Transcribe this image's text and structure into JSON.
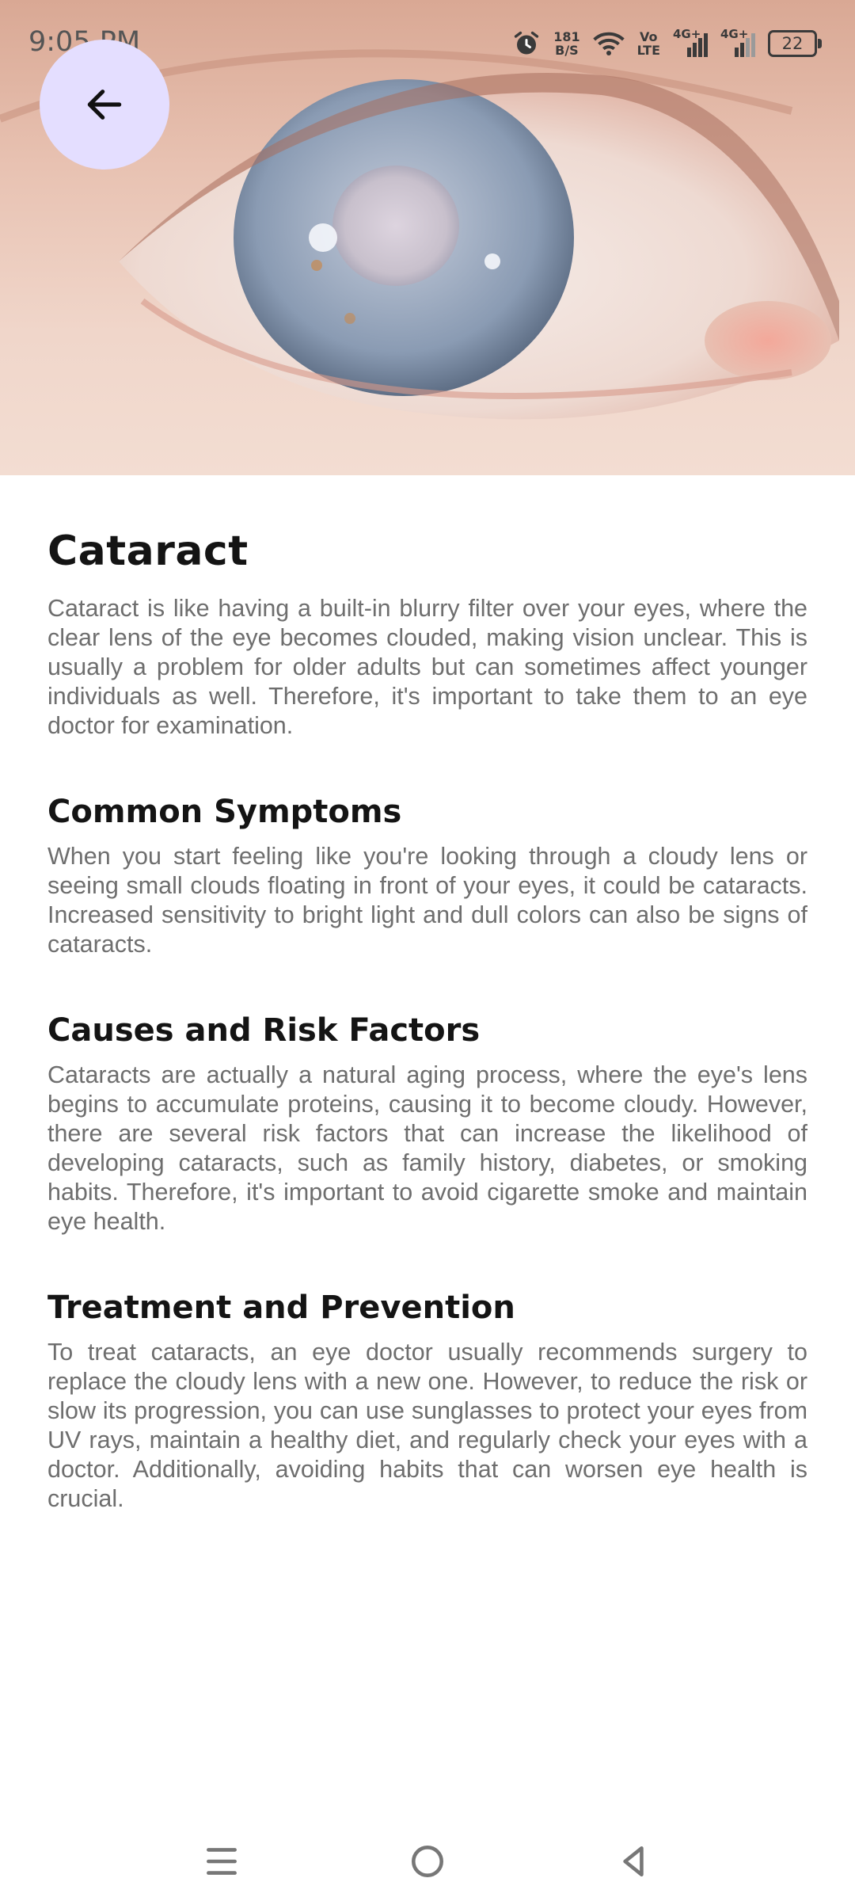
{
  "status_bar": {
    "time": "9:05 PM",
    "net_speed_value": "181",
    "net_speed_unit": "B/S",
    "volte_top": "Vo",
    "volte_bottom": "LTE",
    "signal1_label": "4G+",
    "signal2_label": "4G+",
    "battery_level": "22",
    "icons": [
      "alarm-icon",
      "wifi-icon",
      "signal-icon",
      "signal-icon",
      "battery-icon"
    ]
  },
  "header": {
    "back_icon": "arrow-left-icon",
    "back_button_color": "#e4deff"
  },
  "article": {
    "title": "Cataract",
    "intro": "Cataract is like having a built-in blurry filter over your eyes, where the clear lens of the eye becomes clouded, making vision unclear. This is usually a problem for older adults but can sometimes affect younger individuals as well. Therefore, it's important to take them to an eye doctor for examination.",
    "sections": [
      {
        "heading": "Common Symptoms",
        "body": "When you start feeling like you're looking through a cloudy lens or seeing small clouds floating in front of your eyes, it could be cataracts. Increased sensitivity to bright light and dull colors can also be signs of cataracts."
      },
      {
        "heading": "Causes and Risk Factors",
        "body": "Cataracts are actually a natural aging process, where the eye's lens begins to accumulate proteins, causing it to become cloudy. However, there are several risk factors that can increase the likelihood of developing cataracts, such as family history, diabetes, or smoking habits. Therefore, it's important to avoid cigarette smoke and maintain eye health."
      },
      {
        "heading": "Treatment and Prevention",
        "body": "To treat cataracts, an eye doctor usually recommends surgery to replace the cloudy lens with a new one. However, to reduce the risk or slow its progression, you can use sunglasses to protect your eyes from UV rays, maintain a healthy diet, and regularly check your eyes with a doctor. Additionally, avoiding habits that can worsen eye health is crucial."
      }
    ]
  },
  "nav_bar": {
    "icons": [
      "menu-icon",
      "home-icon",
      "back-triangle-icon"
    ]
  },
  "colors": {
    "title_text": "#141414",
    "body_text": "#6e6e6e",
    "accent": "#e4deff"
  }
}
